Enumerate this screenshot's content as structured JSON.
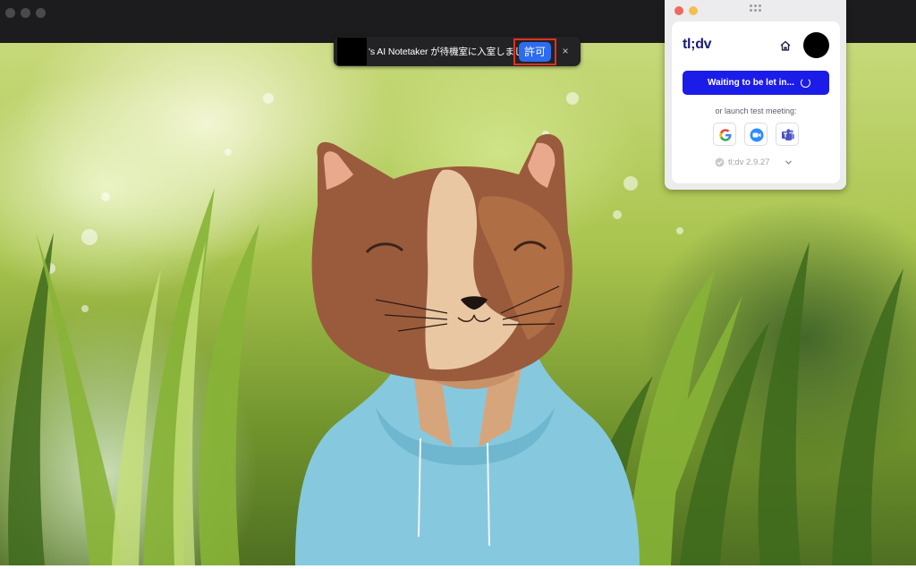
{
  "notification": {
    "message": "'s AI Notetaker が待機室に入室しました",
    "allow_label": "許可",
    "close_label": "×"
  },
  "tldv_popup": {
    "logo": "tl;dv",
    "waiting_button_label": "Waiting to be let in...",
    "launch_label": "or launch test meeting:",
    "apps": [
      {
        "name": "google-meet",
        "icon": "google-g-icon"
      },
      {
        "name": "zoom",
        "icon": "zoom-camera-icon"
      },
      {
        "name": "microsoft-teams",
        "icon": "teams-icon"
      }
    ],
    "version": "tl;dv 2.9.27"
  },
  "colors": {
    "allow_button": "#2d6cf0",
    "highlight_box": "#e0311d",
    "waiting_button": "#1c1ce8",
    "logo": "#1a1a7a",
    "window_chrome": "#1c1c1e"
  }
}
